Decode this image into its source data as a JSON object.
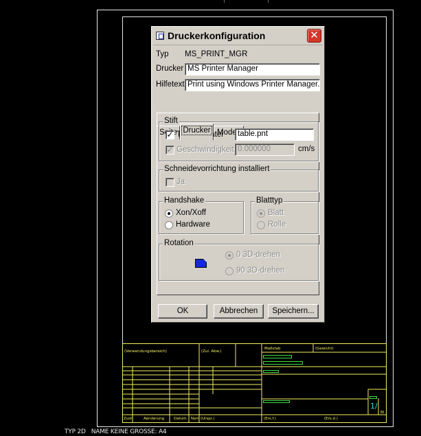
{
  "dialog": {
    "title": "Druckerkonfiguration",
    "close_label": "✕",
    "fields": {
      "type_label": "Typ",
      "type_value": "MS_PRINT_MGR",
      "printer_label": "Drucker",
      "printer_value": "MS Printer Manager",
      "help_label": "Hilfetext",
      "help_value": "Print using Windows Printer Manager."
    },
    "tabs": [
      {
        "label": "Seite",
        "active": false
      },
      {
        "label": "Drucker",
        "active": true
      },
      {
        "label": "Modell",
        "active": false
      }
    ],
    "pen_group": {
      "title": "Stift",
      "table_file_label": "Tabellendatei",
      "table_file_checked": true,
      "table_file_value": "table.pnt",
      "speed_label": "Geschwindigkeit",
      "speed_checked": true,
      "speed_enabled": false,
      "speed_value": "0.000000",
      "speed_unit": "cm/s"
    },
    "cutter_group": {
      "title": "Schneidevorrichtung installiert",
      "yes_label": "Ja",
      "yes_checked": false,
      "enabled": false
    },
    "handshake_group": {
      "title": "Handshake",
      "options": [
        {
          "label": "Xon/Xoff",
          "selected": true
        },
        {
          "label": "Hardware",
          "selected": false
        }
      ]
    },
    "sheet_group": {
      "title": "Blatttyp",
      "enabled": false,
      "options": [
        {
          "label": "Blatt",
          "selected": true
        },
        {
          "label": "Rolle",
          "selected": false
        }
      ]
    },
    "rotation_group": {
      "title": "Rotation",
      "enabled": false,
      "options": [
        {
          "label": "0 3D-drehen",
          "selected": true
        },
        {
          "label": "90 3D-drehen",
          "selected": false
        }
      ]
    },
    "buttons": {
      "ok": "OK",
      "cancel": "Abbrechen",
      "save": "Speichern..."
    }
  },
  "title_block": {
    "usage": "(Verwendungsbereich)",
    "revision": "(Zul. Abw.)",
    "scale": "Maßstab",
    "weight": "(Gewicht)",
    "col_zust": "Zust.",
    "col_change": "Aenderung",
    "col_date": "Datum",
    "col_name": "Nam",
    "col_origin": "(Urspr.)",
    "col_repl_for": "(Ers.f.)",
    "col_repl_by": "(Ers.d.)",
    "sheet": "1/",
    "sheet_label": "Bl"
  },
  "status_line": "TYP 2D   NAME KEINE GROSSE: A4",
  "colors": {
    "background": "#000000",
    "frame": "#e8e8e8",
    "title_block": "#f4f060",
    "title_block_cyan": "#35e0e0",
    "title_block_green": "#40e040",
    "dialog_face": "#d4d0c8",
    "close_button": "#d0382a",
    "rotation_icon": "#1428d8"
  }
}
